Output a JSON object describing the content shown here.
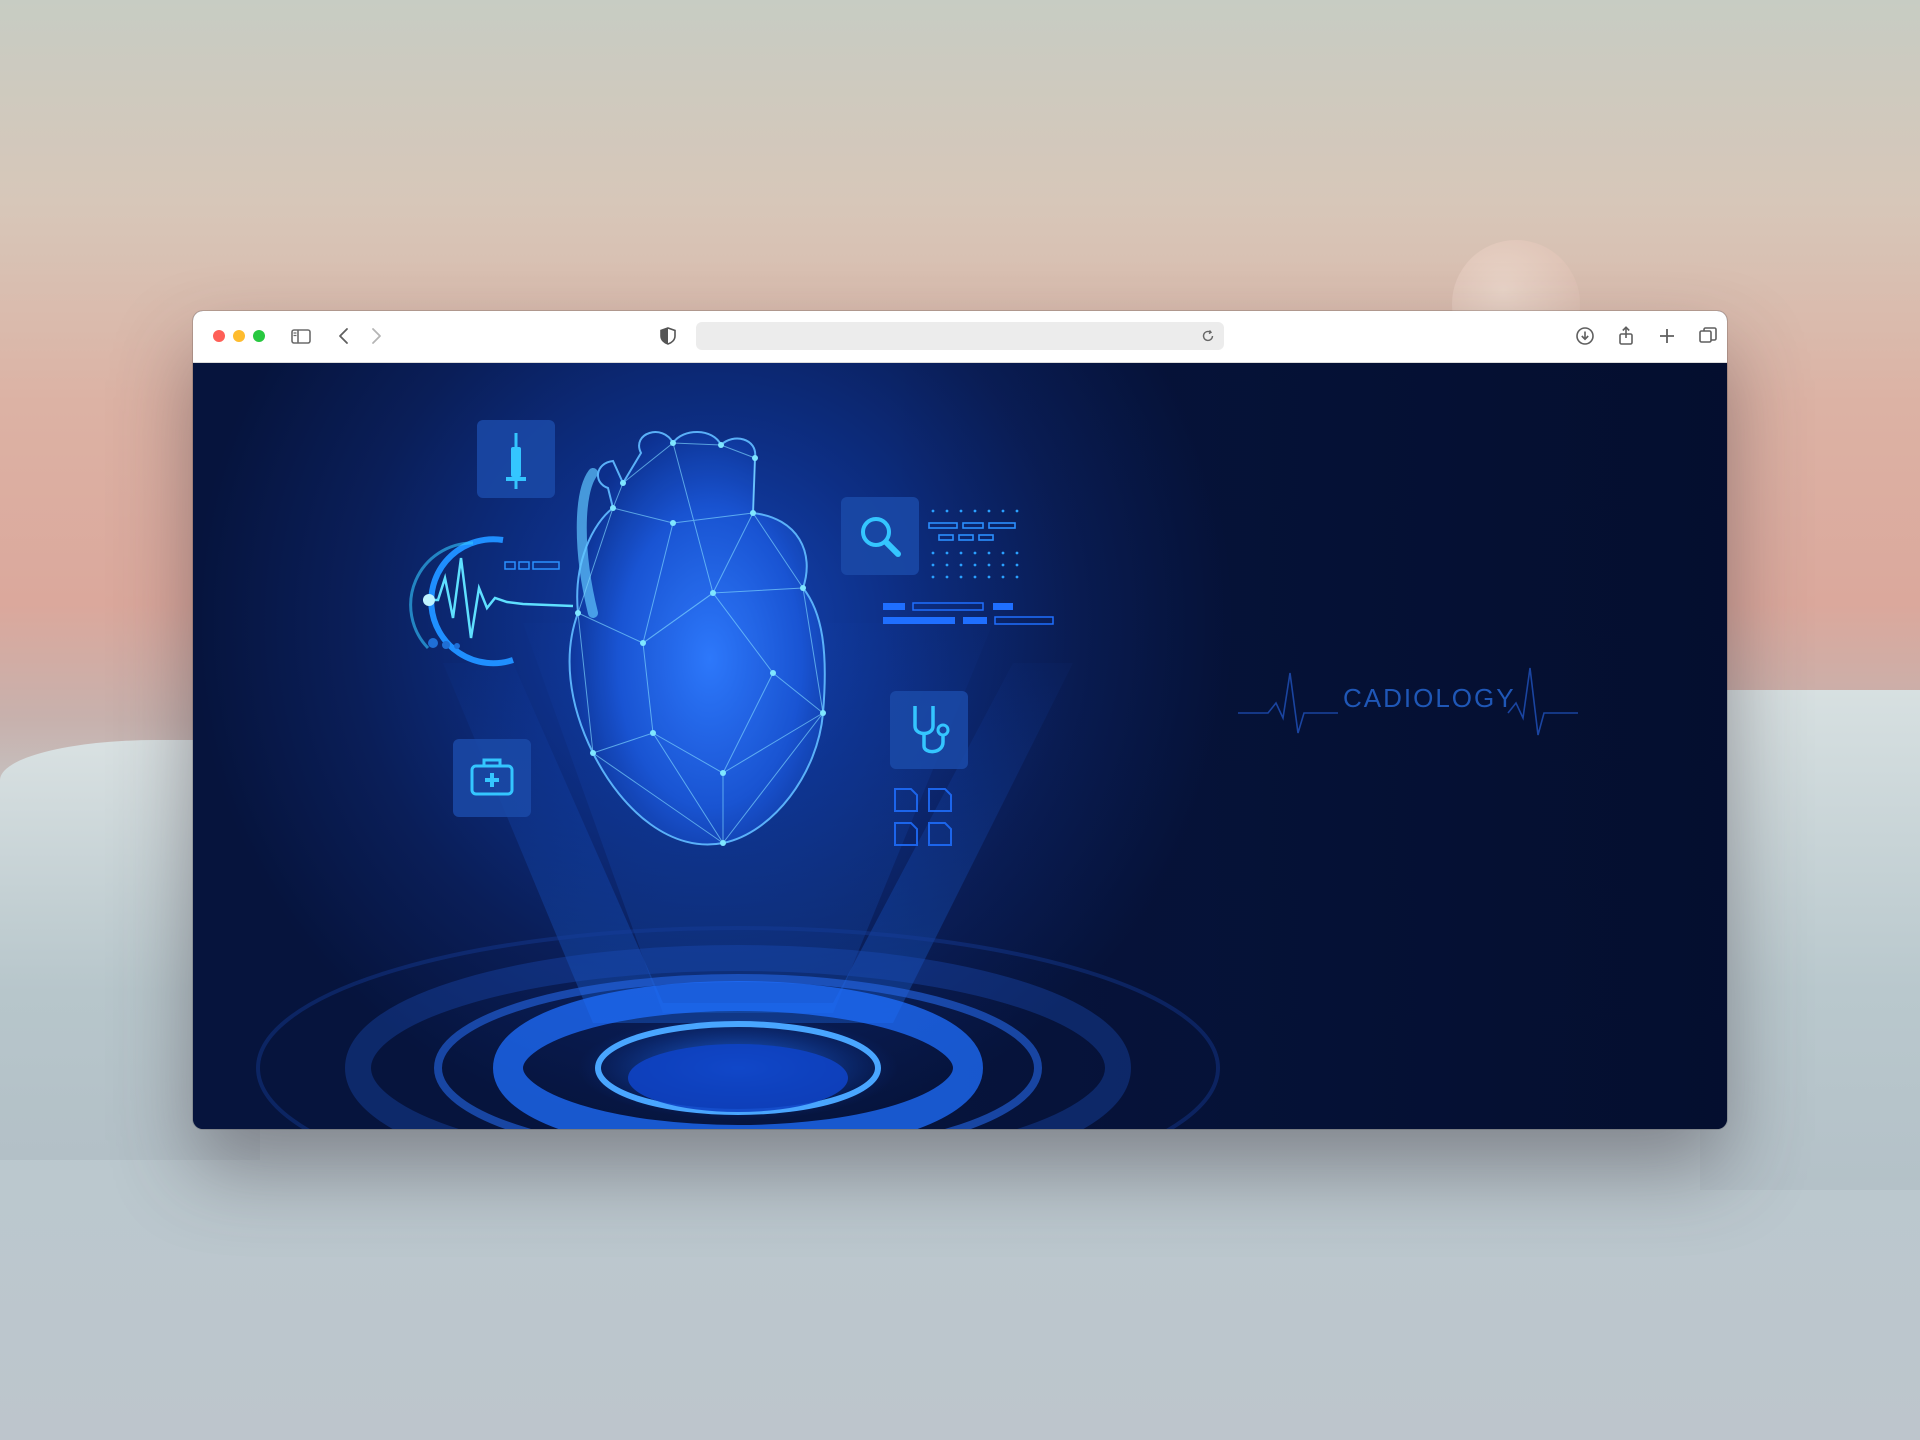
{
  "browser": {
    "buttons": {
      "close": "close",
      "minimize": "minimize",
      "zoom": "zoom"
    },
    "icons": {
      "sidebar": "sidebar-icon",
      "back": "chevron-left-icon",
      "forward": "chevron-right-icon",
      "privacy": "shield-icon",
      "reload": "reload-icon",
      "download": "download-icon",
      "share": "share-icon",
      "new_tab": "plus-icon",
      "tabs": "tabs-overview-icon"
    },
    "address": {
      "value": ""
    }
  },
  "page": {
    "brand_text": "CADIOLOGY",
    "icons": [
      "syringe-icon",
      "heartbeat-gauge-icon",
      "magnifier-icon",
      "first-aid-kit-icon",
      "stethoscope-icon",
      "document-icons",
      "hologram-heart",
      "hologram-platform"
    ]
  },
  "colors": {
    "page_bg": "#0a1e58",
    "accent": "#1f6fff",
    "neon": "#38c8ff",
    "brand_text": "#1f57b7"
  }
}
